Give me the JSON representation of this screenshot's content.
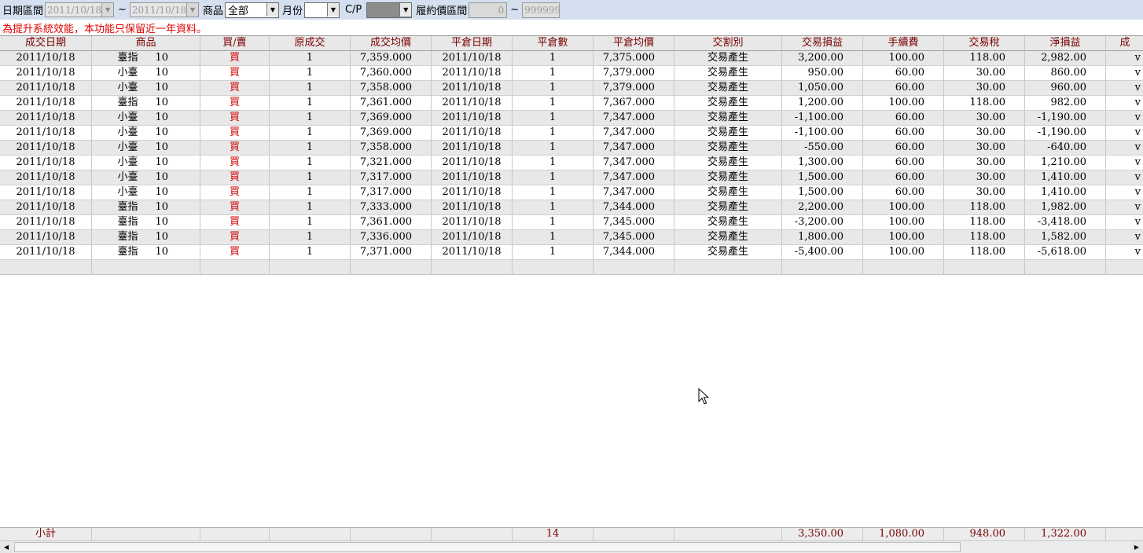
{
  "filters": {
    "date_label": "日期區間",
    "date_from": "2011/10/18",
    "date_sep": "~",
    "date_to": "2011/10/18",
    "product_label": "商品",
    "product_value": "全部",
    "month_label": "月份",
    "month_value": "",
    "cp_label": "C/P",
    "cp_value": "",
    "strike_label": "履約價區間",
    "strike_from": "0",
    "strike_sep": "~",
    "strike_to": "999999"
  },
  "notice": "為提升系統效能，本功能只保留近一年資料。",
  "columns": [
    "成交日期",
    "商品",
    "買/賣",
    "原成交",
    "成交均價",
    "平倉日期",
    "平倉數",
    "平倉均價",
    "交割別",
    "交易損益",
    "手續費",
    "交易稅",
    "淨損益",
    "成"
  ],
  "rows": [
    {
      "date": "2011/10/18",
      "product": "臺指",
      "month": "10",
      "side": "買",
      "orig": "1",
      "price": "7,359.000",
      "close_date": "2011/10/18",
      "close_qty": "1",
      "close_price": "7,375.000",
      "settle": "交易產生",
      "pnl": "3,200.00",
      "fee": "100.00",
      "tax": "118.00",
      "net": "2,982.00",
      "extra": "v"
    },
    {
      "date": "2011/10/18",
      "product": "小臺",
      "month": "10",
      "side": "買",
      "orig": "1",
      "price": "7,360.000",
      "close_date": "2011/10/18",
      "close_qty": "1",
      "close_price": "7,379.000",
      "settle": "交易產生",
      "pnl": "950.00",
      "fee": "60.00",
      "tax": "30.00",
      "net": "860.00",
      "extra": "v"
    },
    {
      "date": "2011/10/18",
      "product": "小臺",
      "month": "10",
      "side": "買",
      "orig": "1",
      "price": "7,358.000",
      "close_date": "2011/10/18",
      "close_qty": "1",
      "close_price": "7,379.000",
      "settle": "交易產生",
      "pnl": "1,050.00",
      "fee": "60.00",
      "tax": "30.00",
      "net": "960.00",
      "extra": "v"
    },
    {
      "date": "2011/10/18",
      "product": "臺指",
      "month": "10",
      "side": "買",
      "orig": "1",
      "price": "7,361.000",
      "close_date": "2011/10/18",
      "close_qty": "1",
      "close_price": "7,367.000",
      "settle": "交易產生",
      "pnl": "1,200.00",
      "fee": "100.00",
      "tax": "118.00",
      "net": "982.00",
      "extra": "v"
    },
    {
      "date": "2011/10/18",
      "product": "小臺",
      "month": "10",
      "side": "買",
      "orig": "1",
      "price": "7,369.000",
      "close_date": "2011/10/18",
      "close_qty": "1",
      "close_price": "7,347.000",
      "settle": "交易產生",
      "pnl": "-1,100.00",
      "fee": "60.00",
      "tax": "30.00",
      "net": "-1,190.00",
      "extra": "v"
    },
    {
      "date": "2011/10/18",
      "product": "小臺",
      "month": "10",
      "side": "買",
      "orig": "1",
      "price": "7,369.000",
      "close_date": "2011/10/18",
      "close_qty": "1",
      "close_price": "7,347.000",
      "settle": "交易產生",
      "pnl": "-1,100.00",
      "fee": "60.00",
      "tax": "30.00",
      "net": "-1,190.00",
      "extra": "v"
    },
    {
      "date": "2011/10/18",
      "product": "小臺",
      "month": "10",
      "side": "買",
      "orig": "1",
      "price": "7,358.000",
      "close_date": "2011/10/18",
      "close_qty": "1",
      "close_price": "7,347.000",
      "settle": "交易產生",
      "pnl": "-550.00",
      "fee": "60.00",
      "tax": "30.00",
      "net": "-640.00",
      "extra": "v"
    },
    {
      "date": "2011/10/18",
      "product": "小臺",
      "month": "10",
      "side": "買",
      "orig": "1",
      "price": "7,321.000",
      "close_date": "2011/10/18",
      "close_qty": "1",
      "close_price": "7,347.000",
      "settle": "交易產生",
      "pnl": "1,300.00",
      "fee": "60.00",
      "tax": "30.00",
      "net": "1,210.00",
      "extra": "v"
    },
    {
      "date": "2011/10/18",
      "product": "小臺",
      "month": "10",
      "side": "買",
      "orig": "1",
      "price": "7,317.000",
      "close_date": "2011/10/18",
      "close_qty": "1",
      "close_price": "7,347.000",
      "settle": "交易產生",
      "pnl": "1,500.00",
      "fee": "60.00",
      "tax": "30.00",
      "net": "1,410.00",
      "extra": "v"
    },
    {
      "date": "2011/10/18",
      "product": "小臺",
      "month": "10",
      "side": "買",
      "orig": "1",
      "price": "7,317.000",
      "close_date": "2011/10/18",
      "close_qty": "1",
      "close_price": "7,347.000",
      "settle": "交易產生",
      "pnl": "1,500.00",
      "fee": "60.00",
      "tax": "30.00",
      "net": "1,410.00",
      "extra": "v"
    },
    {
      "date": "2011/10/18",
      "product": "臺指",
      "month": "10",
      "side": "買",
      "orig": "1",
      "price": "7,333.000",
      "close_date": "2011/10/18",
      "close_qty": "1",
      "close_price": "7,344.000",
      "settle": "交易產生",
      "pnl": "2,200.00",
      "fee": "100.00",
      "tax": "118.00",
      "net": "1,982.00",
      "extra": "v"
    },
    {
      "date": "2011/10/18",
      "product": "臺指",
      "month": "10",
      "side": "買",
      "orig": "1",
      "price": "7,361.000",
      "close_date": "2011/10/18",
      "close_qty": "1",
      "close_price": "7,345.000",
      "settle": "交易產生",
      "pnl": "-3,200.00",
      "fee": "100.00",
      "tax": "118.00",
      "net": "-3,418.00",
      "extra": "v"
    },
    {
      "date": "2011/10/18",
      "product": "臺指",
      "month": "10",
      "side": "買",
      "orig": "1",
      "price": "7,336.000",
      "close_date": "2011/10/18",
      "close_qty": "1",
      "close_price": "7,345.000",
      "settle": "交易產生",
      "pnl": "1,800.00",
      "fee": "100.00",
      "tax": "118.00",
      "net": "1,582.00",
      "extra": "v"
    },
    {
      "date": "2011/10/18",
      "product": "臺指",
      "month": "10",
      "side": "買",
      "orig": "1",
      "price": "7,371.000",
      "close_date": "2011/10/18",
      "close_qty": "1",
      "close_price": "7,344.000",
      "settle": "交易產生",
      "pnl": "-5,400.00",
      "fee": "100.00",
      "tax": "118.00",
      "net": "-5,618.00",
      "extra": "v"
    }
  ],
  "totals": {
    "label": "小計",
    "close_qty": "14",
    "pnl": "3,350.00",
    "fee": "1,080.00",
    "tax": "948.00",
    "net": "1,322.00"
  },
  "icons": {
    "dropdown": "chevron-down-icon",
    "scroll_left": "arrow-left-icon",
    "scroll_right": "arrow-right-icon",
    "cursor": "mouse-pointer-icon"
  },
  "colors": {
    "header_bg": "#d4dff0",
    "notice": "#e00000",
    "buy": "#d00000",
    "column_header_text": "#7a0000",
    "alt_row": "#e8e8e8"
  }
}
